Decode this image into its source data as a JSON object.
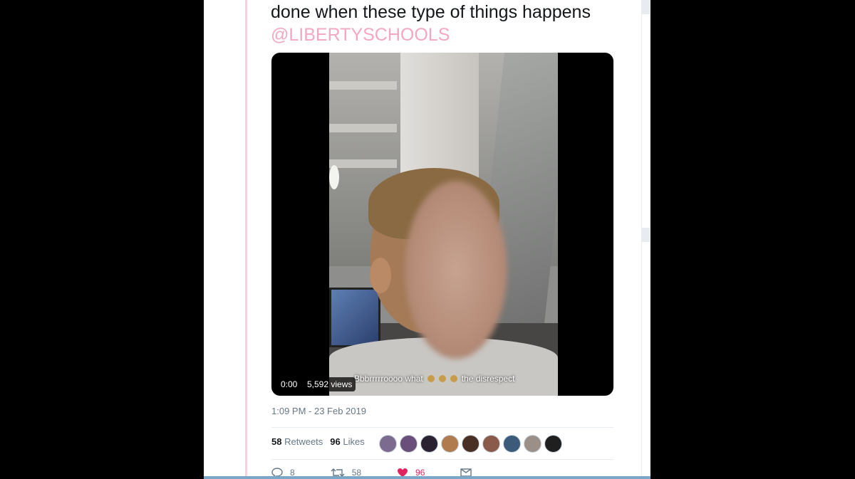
{
  "tweet": {
    "text_line": "done when these type of things happens",
    "mention": "@LIBERTYSCHOOLS"
  },
  "video": {
    "time": "0:00",
    "views": "5,592 views",
    "caption_start": "Bbbrrrrroooo what",
    "caption_end": "the disrespect"
  },
  "meta": {
    "timestamp": "1:09 PM - 23 Feb 2019"
  },
  "stats": {
    "retweets_count": "58",
    "retweets_label": "Retweets",
    "likes_count": "96",
    "likes_label": "Likes"
  },
  "actions": {
    "reply_count": "8",
    "retweet_count": "58",
    "like_count": "96"
  },
  "colors": {
    "like": "#e0245e",
    "mention": "#f4a7c0",
    "thread_line": "#f3d3dc"
  },
  "icons": [
    "reply-icon",
    "retweet-icon",
    "heart-icon",
    "message-icon"
  ]
}
